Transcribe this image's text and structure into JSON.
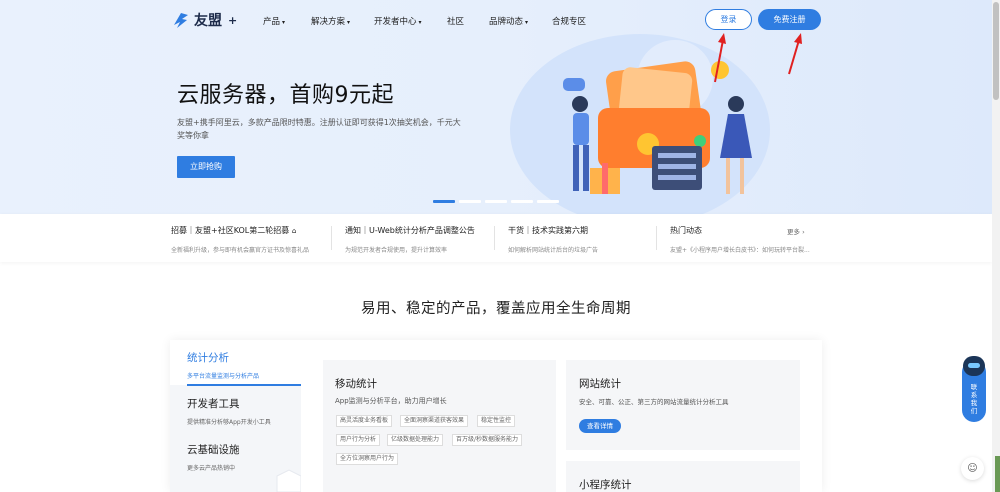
{
  "nav": {
    "logo_text": "友盟",
    "logo_plus": "+",
    "items": [
      "产品",
      "解决方案",
      "开发者中心",
      "社区",
      "品牌动态",
      "合规专区"
    ],
    "login": "登录",
    "register": "免费注册"
  },
  "hero": {
    "title": "云服务器，首购9元起",
    "desc": "友盟+携手阿里云，多款产品限时特惠。注册认证即可获得1次抽奖机会，千元大奖等你拿",
    "button": "立即抢购",
    "slides": 5,
    "active_slide": 0
  },
  "news": [
    {
      "title": "招募｜友盟+社区KOL第二轮招募",
      "sub": "全新福利升级，参与即有机会赢官方证书及惊喜礼品"
    },
    {
      "title": "通知｜U-Web统计分析产品调整公告",
      "sub": "为规范开发者合规使用，提升计算效率"
    },
    {
      "title": "干货｜技术实践第六期",
      "sub": "如何解析网站统计后台的垃圾广告"
    },
    {
      "title": "热门动态",
      "sub": "友盟+《小程序用户增长白皮书》：如何玩转平台裂..."
    }
  ],
  "news_more": "更多 ›",
  "section_title": "易用、稳定的产品，覆盖应用全生命周期",
  "tabs": [
    {
      "title": "统计分析",
      "sub": "多平台流量监测与分析产品"
    },
    {
      "title": "开发者工具",
      "sub": "提供精准分析够App开发小工具"
    },
    {
      "title": "云基础设施",
      "sub": "更多云产品热销中"
    }
  ],
  "cards": {
    "mobile": {
      "title": "移动统计",
      "desc": "App监测与分析平台，助力用户增长",
      "tags": [
        "高灵活度业务看板",
        "全面洞察渠道获客效果",
        "稳定性监控",
        "用户行为分析",
        "亿级数据处理能力",
        "百万级/秒数据服务能力",
        "全方位洞察用户行为"
      ]
    },
    "web": {
      "title": "网站统计",
      "desc": "安全、可靠、公正、第三方的网站流量统计分析工具",
      "button": "查看详情"
    },
    "mini": {
      "title": "小程序统计"
    }
  },
  "float": {
    "contact": "联系我们"
  },
  "colors": {
    "accent": "#2f7de1",
    "arrow": "#e02020"
  }
}
